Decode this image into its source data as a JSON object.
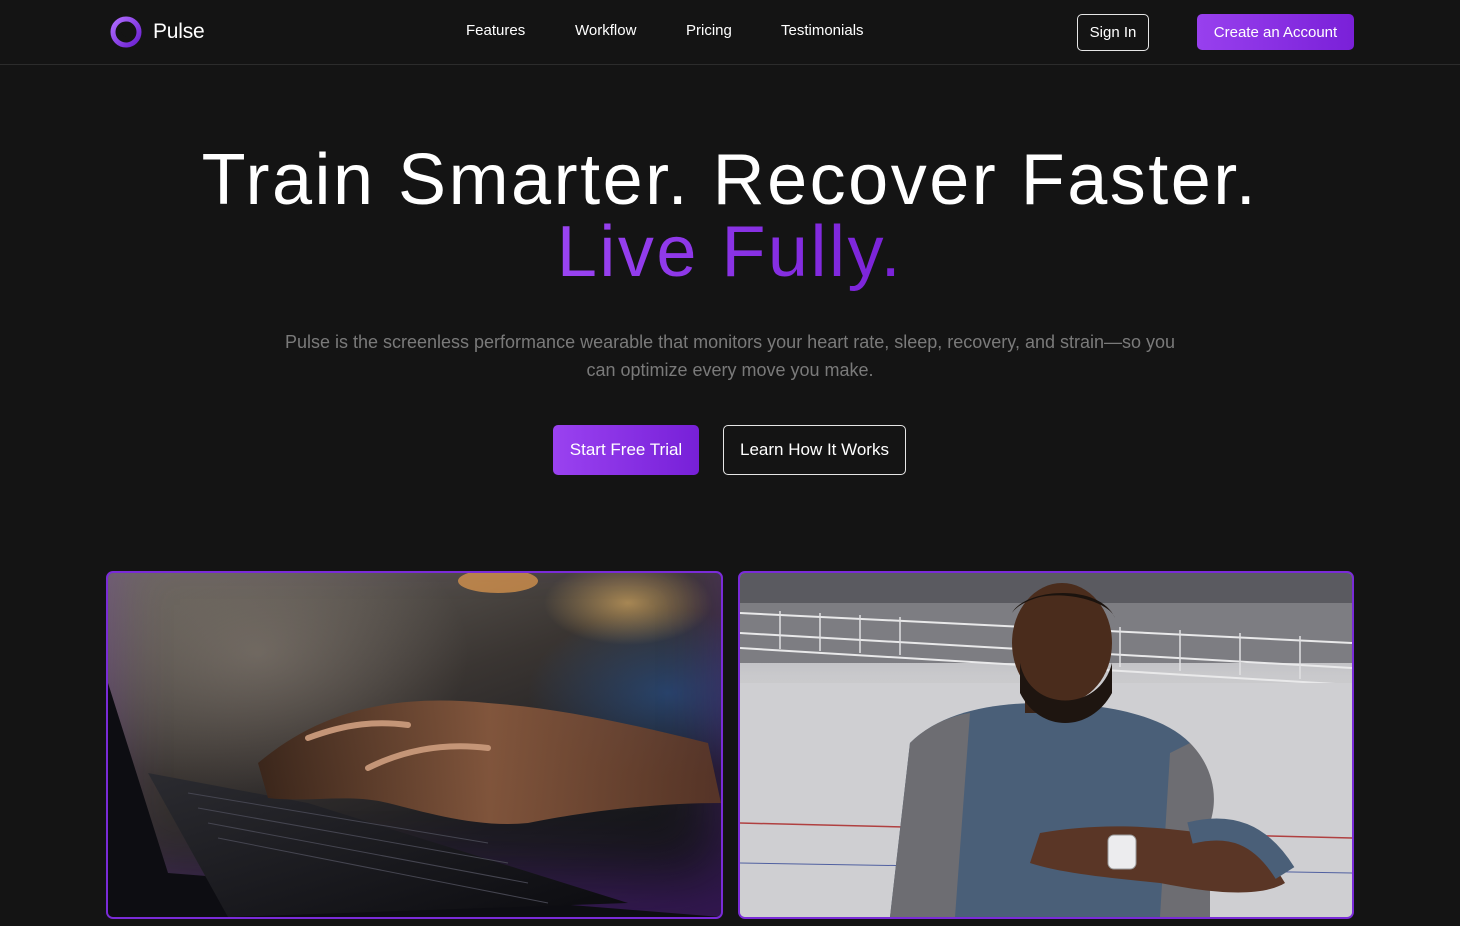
{
  "brand": {
    "name": "Pulse",
    "accent_color": "#8b35e8"
  },
  "nav": {
    "links": [
      "Features",
      "Workflow",
      "Pricing",
      "Testimonials"
    ],
    "sign_in": "Sign In",
    "create_account": "Create an Account"
  },
  "hero": {
    "title_line1": "Train Smarter. Recover Faster.",
    "title_line2": "Live Fully.",
    "subtitle": "Pulse is the screenless performance wearable that monitors your heart rate, sleep, recovery, and strain—so you can optimize every move you make.",
    "primary_cta": "Start Free Trial",
    "secondary_cta": "Learn How It Works"
  },
  "images": [
    {
      "icon": "laptop-typing-photo"
    },
    {
      "icon": "athlete-checking-watch-photo"
    }
  ]
}
